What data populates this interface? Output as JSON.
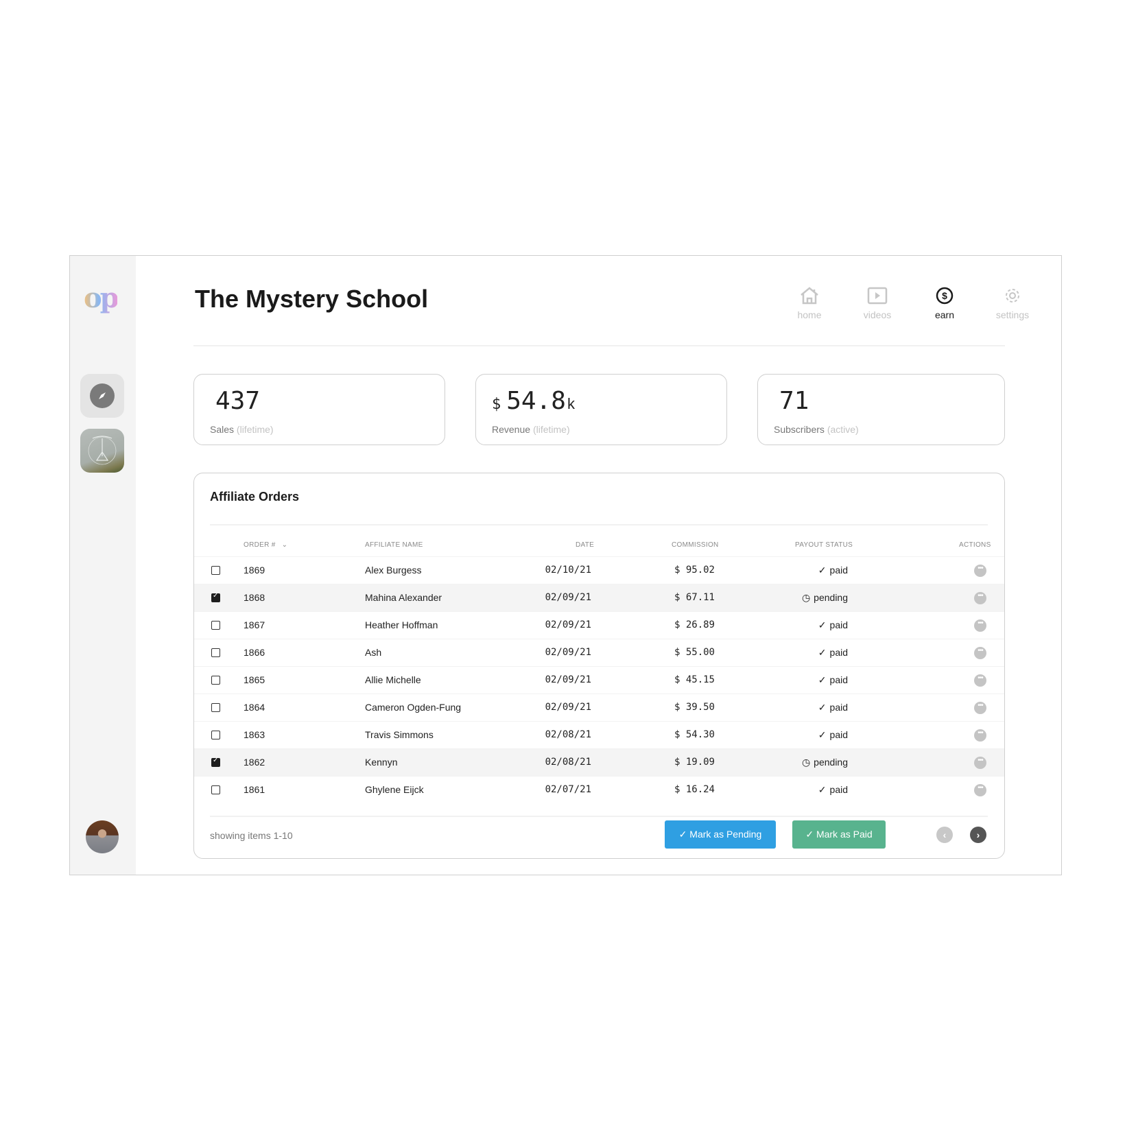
{
  "app": {
    "logo_text": "op",
    "title": "The Mystery School"
  },
  "nav": [
    {
      "label": "home",
      "icon": "home-icon",
      "active": false
    },
    {
      "label": "videos",
      "icon": "video-play-icon",
      "active": false
    },
    {
      "label": "earn",
      "icon": "dollar-circle-icon",
      "active": true
    },
    {
      "label": "settings",
      "icon": "gear-icon",
      "active": false
    }
  ],
  "sidebar": {
    "items": [
      {
        "name": "explore",
        "icon": "compass-icon"
      },
      {
        "name": "channel",
        "icon": "channel-thumbnail"
      }
    ],
    "user": "avatar"
  },
  "stats": [
    {
      "prefix": "",
      "value": "437",
      "suffix": "",
      "label": "Sales",
      "sub": "(lifetime)"
    },
    {
      "prefix": "$",
      "value": "54.8",
      "suffix": "k",
      "label": "Revenue",
      "sub": "(lifetime)"
    },
    {
      "prefix": "",
      "value": "71",
      "suffix": "",
      "label": "Subscribers",
      "sub": "(active)"
    }
  ],
  "orders": {
    "title": "Affiliate Orders",
    "columns": [
      "ORDER #",
      "AFFILIATE NAME",
      "DATE",
      "COMMISSION",
      "PAYOUT STATUS",
      "ACTIONS"
    ],
    "rows": [
      {
        "order": "1869",
        "name": "Alex Burgess",
        "date": "02/10/21",
        "commission": "$ 95.02",
        "status": "paid",
        "selected": false
      },
      {
        "order": "1868",
        "name": "Mahina Alexander",
        "date": "02/09/21",
        "commission": "$ 67.11",
        "status": "pending",
        "selected": true
      },
      {
        "order": "1867",
        "name": "Heather Hoffman",
        "date": "02/09/21",
        "commission": "$ 26.89",
        "status": "paid",
        "selected": false
      },
      {
        "order": "1866",
        "name": "Ash",
        "date": "02/09/21",
        "commission": "$ 55.00",
        "status": "paid",
        "selected": false
      },
      {
        "order": "1865",
        "name": "Allie Michelle",
        "date": "02/09/21",
        "commission": "$ 45.15",
        "status": "paid",
        "selected": false
      },
      {
        "order": "1864",
        "name": "Cameron Ogden-Fung",
        "date": "02/09/21",
        "commission": "$ 39.50",
        "status": "paid",
        "selected": false
      },
      {
        "order": "1863",
        "name": "Travis Simmons",
        "date": "02/08/21",
        "commission": "$ 54.30",
        "status": "paid",
        "selected": false
      },
      {
        "order": "1862",
        "name": "Kennyn",
        "date": "02/08/21",
        "commission": "$ 19.09",
        "status": "pending",
        "selected": true
      },
      {
        "order": "1861",
        "name": "Ghylene Eijck",
        "date": "02/07/21",
        "commission": "$ 16.24",
        "status": "paid",
        "selected": false
      }
    ],
    "footer": {
      "showing": "showing items 1-10",
      "mark_pending": "✓ Mark as Pending",
      "mark_paid": "✓ Mark as Paid"
    }
  },
  "colors": {
    "pending_button": "#2f9fe2",
    "paid_button": "#58b38e"
  }
}
